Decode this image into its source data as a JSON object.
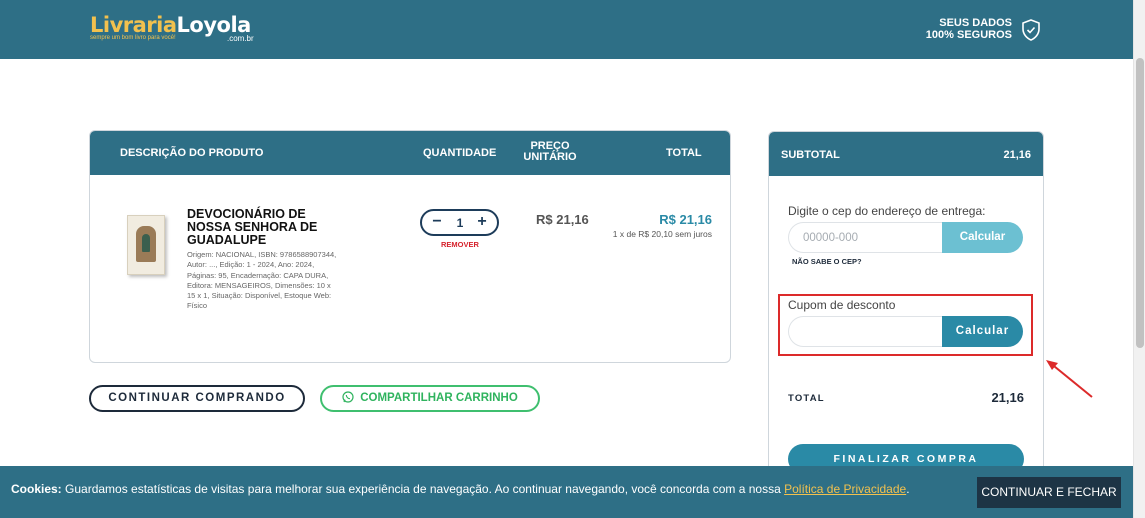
{
  "header": {
    "logo_part1": "Livraria",
    "logo_part2": "Loyola",
    "logo_tagline": "sempre um bom livro para você!",
    "logo_domain": ".com.br",
    "secure_line1": "SEUS DADOS",
    "secure_line2": "100% SEGUROS"
  },
  "cart": {
    "columns": {
      "description": "DESCRIÇÃO DO PRODUTO",
      "quantity": "QUANTIDADE",
      "unit_price_line1": "PREÇO",
      "unit_price_line2": "UNITÁRIO",
      "total": "TOTAL"
    },
    "item": {
      "title": "DEVOCIONÁRIO DE NOSSA SENHORA DE GUADALUPE",
      "meta": "Origem: NACIONAL, ISBN: 9786588907344, Autor: ..., Edição: 1 - 2024, Ano: 2024, Páginas: 95, Encadernação: CAPA DURA, Editora: MENSAGEIROS, Dimensões: 10 x 15 x 1, Situação: Disponível, Estoque Web: Físico",
      "quantity_minus": "−",
      "quantity": "1",
      "quantity_plus": "+",
      "remove": "REMOVER",
      "unit_price": "R$ 21,16",
      "total": "R$ 21,16",
      "total_note": "1 x de R$ 20,10 sem juros"
    },
    "continue_button": "CONTINUAR COMPRANDO",
    "share_button": "COMPARTILHAR CARRINHO"
  },
  "summary": {
    "subtotal_label": "SUBTOTAL",
    "subtotal_value": "21,16",
    "cep_label": "Digite o cep do endereço de entrega:",
    "cep_placeholder": "00000-000",
    "cep_button": "Calcular",
    "no_cep": "NÃO SABE O CEP?",
    "coupon_label": "Cupom de desconto",
    "coupon_button": "Calcular",
    "total_label": "TOTAL",
    "total_value": "21,16",
    "finalize_button": "FINALIZAR COMPRA"
  },
  "cookie": {
    "prefix": "Cookies:",
    "text": " Guardamos estatísticas de visitas para melhorar sua experiência de navegação. Ao continuar navegando, você concorda com a nossa ",
    "link": "Política de Privacidade",
    "suffix": ".",
    "button": "CONTINUAR E FECHAR"
  },
  "colors": {
    "brand_teal": "#2e6f86",
    "accent_blue": "#2a8aa6",
    "logo_gold": "#f2c14e",
    "whatsapp_green": "#2fb35e",
    "remove_red": "#d6222c",
    "highlight_red": "#dc2a2a"
  }
}
